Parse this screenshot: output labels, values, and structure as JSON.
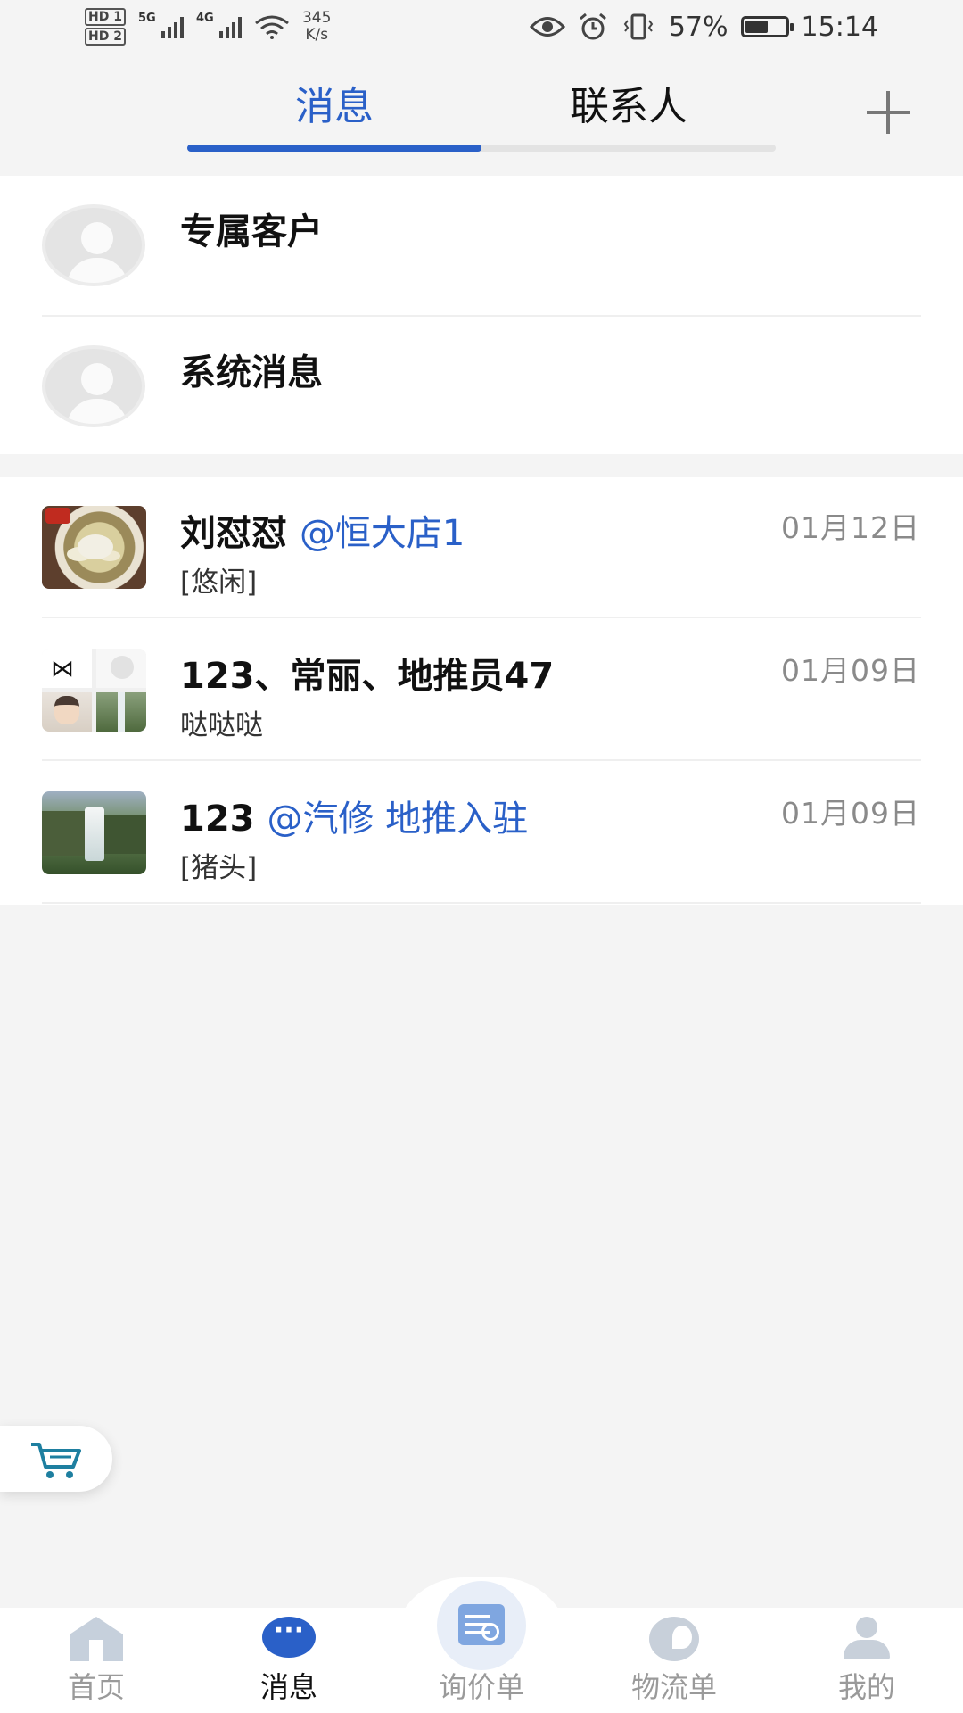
{
  "status_bar": {
    "sim1": "HD 1",
    "sim2": "HD 2",
    "net1": "5G",
    "net2": "4G",
    "speed_value": "345",
    "speed_unit": "K/s",
    "battery": "57%",
    "battery_level": 0.57,
    "time": "15:14"
  },
  "tabs": {
    "messages": "消息",
    "contacts": "联系人"
  },
  "pinned": [
    {
      "title": "专属客户"
    },
    {
      "title": "系统消息"
    }
  ],
  "conversations": [
    {
      "title": "刘怼怼",
      "mention": "@恒大店1",
      "preview": "[悠闲]",
      "date": "01月12日",
      "avatar_icon": "food-photo-icon"
    },
    {
      "title": "123、常丽、地推员47",
      "mention": "",
      "preview": "哒哒哒",
      "date": "01月09日",
      "avatar_icon": "group-avatar-icon"
    },
    {
      "title": "123",
      "mention": "@汽修 地推入驻",
      "preview": "[猪头]",
      "date": "01月09日",
      "avatar_icon": "waterfall-photo-icon"
    }
  ],
  "bottom_nav": [
    {
      "label": "首页",
      "icon": "home-icon",
      "active": false
    },
    {
      "label": "消息",
      "icon": "chat-bubble-icon",
      "active": true
    },
    {
      "label": "询价单",
      "icon": "quote-search-icon",
      "active": false
    },
    {
      "label": "物流单",
      "icon": "logistics-icon",
      "active": false
    },
    {
      "label": "我的",
      "icon": "user-icon",
      "active": false
    }
  ],
  "colors": {
    "accent": "#2a60c8",
    "background": "#f4f4f4",
    "cart": "#1e7fa0"
  }
}
